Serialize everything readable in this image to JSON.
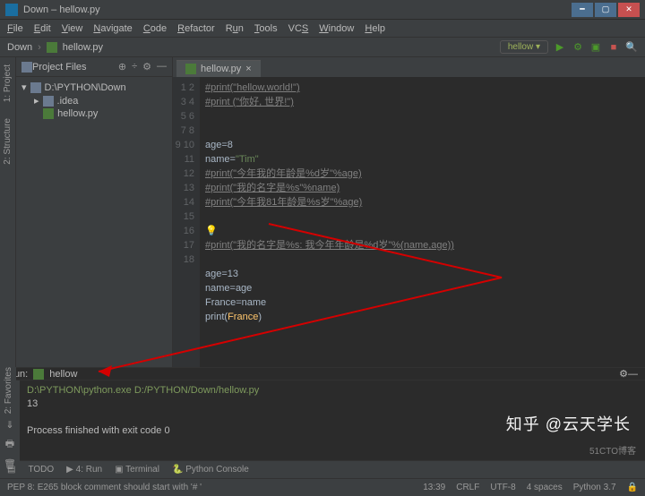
{
  "title": "Down – hellow.py",
  "menus": [
    "File",
    "Edit",
    "View",
    "Navigate",
    "Code",
    "Refactor",
    "Run",
    "Tools",
    "VCS",
    "Window",
    "Help"
  ],
  "breadcrumb": {
    "root": "Down",
    "file": "hellow.py"
  },
  "runconfig": "hellow",
  "project": {
    "header": "Project Files",
    "root": "D:\\PYTHON\\Down",
    "items": [
      ".idea",
      "hellow.py"
    ]
  },
  "tabs": {
    "active": "hellow.py"
  },
  "code": {
    "lines": [
      "#print(\"hellow,world!\")",
      "#print (\"你好, 世界!\")",
      "",
      "",
      "age=8",
      "name=\"Tim\"",
      "#print(\"今年我的年龄是%d岁\"%age)",
      "#print(\"我的名字是%s\"%name)",
      "#print(\"今年我81年龄是%s岁\"%age)",
      "",
      "",
      "#print(\"我的名字是%s: 我今年年龄是%d岁\"%(name,age))",
      "",
      "age=13",
      "name=age",
      "France=name",
      "print(France)"
    ],
    "gutter": [
      "1",
      "2",
      "3",
      "4",
      "5",
      "6",
      "7",
      "8",
      "9",
      "10",
      "11",
      "12",
      "13",
      "14",
      "15",
      "16",
      "17",
      "18"
    ]
  },
  "runpanel": {
    "label": "Run:",
    "name": "hellow",
    "path": "D:\\PYTHON\\python.exe D:/PYTHON/Down/hellow.py",
    "out": "13",
    "exit": "Process finished with exit code 0"
  },
  "bottomTools": [
    "TODO",
    "4: Run",
    "Terminal",
    "Python Console"
  ],
  "status": {
    "left": "PEP 8: E265 block comment should start with '# '",
    "right": [
      "13:39",
      "CRLF",
      "UTF-8",
      "4 spaces",
      "Python 3.7"
    ]
  },
  "watermark": "知乎 @云天学长",
  "watermark2": "51CTO博客"
}
